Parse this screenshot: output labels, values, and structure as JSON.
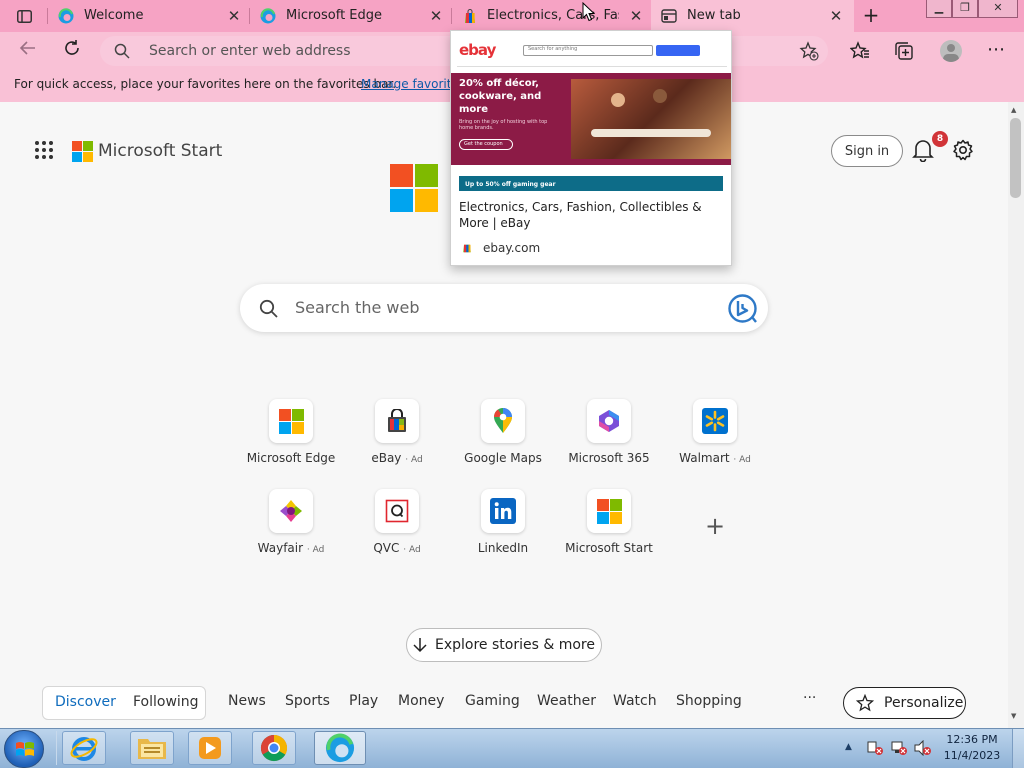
{
  "tabs": [
    {
      "title": "Welcome",
      "icon": "edge-icon"
    },
    {
      "title": "Microsoft Edge",
      "icon": "edge-icon"
    },
    {
      "title": "Electronics, Cars, Fashion",
      "icon": "ebay-shopping-bag-icon"
    },
    {
      "title": "New tab",
      "icon": "new-tab-icon",
      "active": true
    }
  ],
  "address_bar": {
    "placeholder": "Search or enter web address"
  },
  "favorites_bar": {
    "message": "For quick access, place your favorites here on the favorites bar.",
    "link": "Manage favorite"
  },
  "tab_preview": {
    "title": "Electronics, Cars, Fashion, Collectibles & More | eBay",
    "domain": "ebay.com",
    "thumbnail": {
      "logo": "ebay",
      "search_placeholder": "Search for anything",
      "promo_headline": "20% off décor, cookware, and more",
      "promo_sub": "Bring on the joy of hosting with top home brands.",
      "promo_button": "Get the coupon",
      "banner": "Up to 50% off gaming gear"
    }
  },
  "header": {
    "brand": "Microsoft Start",
    "sign_in": "Sign in",
    "notification_count": "8"
  },
  "search": {
    "placeholder": "Search the web"
  },
  "quick_links": [
    {
      "label": "Microsoft Edge",
      "ad": ""
    },
    {
      "label": "eBay",
      "ad": "· Ad"
    },
    {
      "label": "Google Maps",
      "ad": ""
    },
    {
      "label": "Microsoft 365",
      "ad": ""
    },
    {
      "label": "Walmart",
      "ad": "· Ad"
    },
    {
      "label": "Wayfair",
      "ad": "· Ad"
    },
    {
      "label": "QVC",
      "ad": "· Ad"
    },
    {
      "label": "LinkedIn",
      "ad": ""
    },
    {
      "label": "Microsoft Start",
      "ad": ""
    }
  ],
  "explore": "Explore stories & more",
  "feed_nav": {
    "toggle": [
      "Discover",
      "Following"
    ],
    "categories": [
      "News",
      "Sports",
      "Play",
      "Money",
      "Gaming",
      "Weather",
      "Watch",
      "Shopping"
    ],
    "more": "···",
    "personalize": "Personalize"
  },
  "taskbar": {
    "time": "12:36 PM",
    "date": "11/4/2023"
  },
  "colors": {
    "chrome_pink": "#f6a3c4",
    "accent_blue": "#0f6cbd",
    "page_bg": "#f7f7f7"
  }
}
